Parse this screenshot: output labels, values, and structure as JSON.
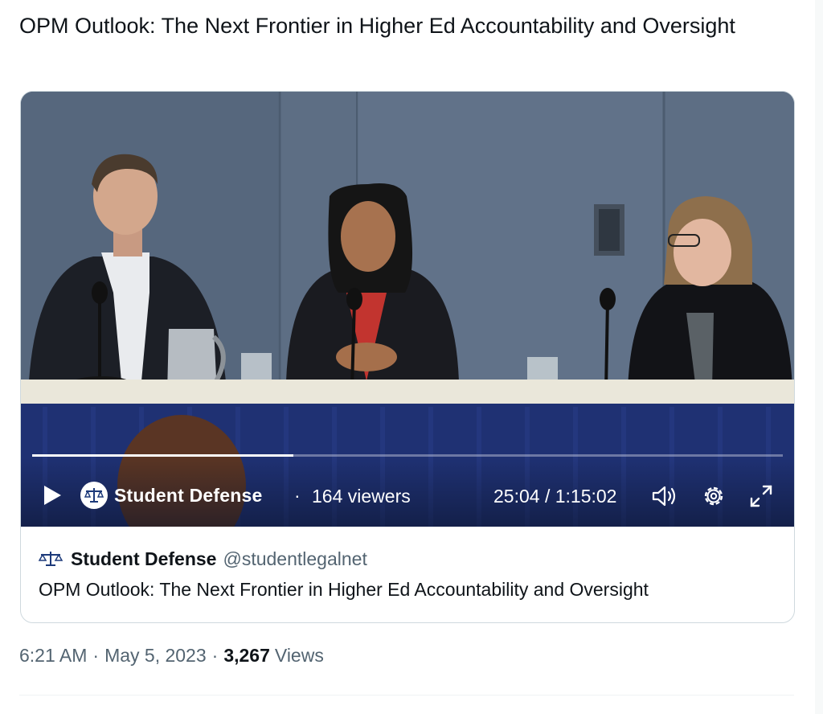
{
  "tweet": {
    "text": "OPM Outlook: The Next Frontier in Higher Ed Accountability and Oversight"
  },
  "video": {
    "progress": 0.348,
    "channel_name": "Student Defense",
    "separator": "·",
    "viewers": "164 viewers",
    "time": "25:04 / 1:15:02"
  },
  "card": {
    "author_name": "Student Defense",
    "author_handle": "@studentlegalnet",
    "description": "OPM Outlook: The Next Frontier in Higher Ed Accountability and Oversight"
  },
  "meta": {
    "time": "6:21 AM",
    "sep": "·",
    "date": "May 5, 2023",
    "views_count": "3,267",
    "views_label": "Views"
  },
  "colors": {
    "text": "#0f1419",
    "secondary": "#536471",
    "border": "#cfd9de"
  },
  "icons": {
    "play": "play-icon",
    "avatar": "scales-icon",
    "volume": "volume-icon",
    "settings": "gear-icon",
    "fullscreen": "expand-icon"
  }
}
